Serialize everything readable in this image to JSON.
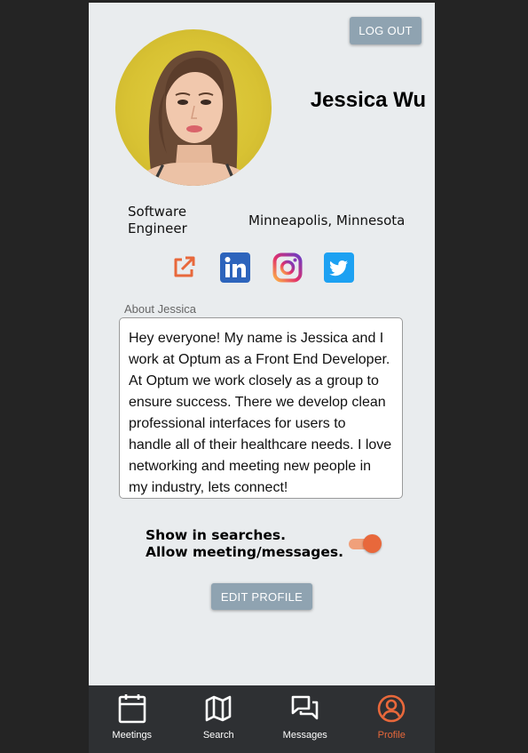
{
  "header": {
    "logout_label": "LOG OUT"
  },
  "profile": {
    "name": "Jessica Wu",
    "job_title": "Software Engineer",
    "location": "Minneapolis, Minnesota",
    "avatar_bg": "#d8c233"
  },
  "social": [
    {
      "icon": "external-link-icon",
      "color": "#e8683b"
    },
    {
      "icon": "linkedin-icon",
      "color": "#2d64bc"
    },
    {
      "icon": "instagram-icon",
      "color": "#c13584"
    },
    {
      "icon": "twitter-icon",
      "color": "#1da1f2"
    }
  ],
  "about": {
    "label": "About Jessica",
    "text": "Hey everyone! My name is Jessica and I work at Optum as a Front End Developer. At Optum we work closely as a group to ensure success. There we develop clean professional interfaces for users to handle all of their healthcare needs. I love networking and meeting new people in my industry, lets connect!"
  },
  "visibility": {
    "line1": "Show in searches.",
    "line2": "Allow meeting/messages.",
    "enabled": true
  },
  "edit_label": "EDIT PROFILE",
  "nav": {
    "items": [
      {
        "label": "Meetings",
        "icon": "calendar-icon"
      },
      {
        "label": "Search",
        "icon": "map-icon"
      },
      {
        "label": "Messages",
        "icon": "chat-icon"
      },
      {
        "label": "Profile",
        "icon": "user-circle-icon",
        "active": true
      }
    ]
  },
  "colors": {
    "accent": "#e8683b",
    "button": "#8fa3b1",
    "nav_bg": "#2e3033",
    "screen_bg": "#e9ecee"
  }
}
